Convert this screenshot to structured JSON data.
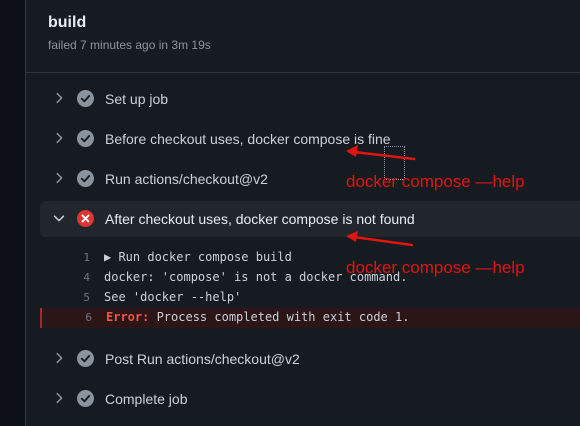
{
  "job": {
    "title": "build",
    "subtitle": "failed 7 minutes ago in 3m 19s"
  },
  "steps": [
    {
      "label": "Set up job",
      "status": "success"
    },
    {
      "label": "Before checkout uses, docker compose is fine",
      "status": "success"
    },
    {
      "label": "Run actions/checkout@v2",
      "status": "success"
    },
    {
      "label": "After checkout uses, docker compose is not found",
      "status": "failure"
    },
    {
      "label": "Post Run actions/checkout@v2",
      "status": "success"
    },
    {
      "label": "Complete job",
      "status": "success"
    }
  ],
  "log": [
    {
      "num": "1",
      "text": "▶ Run docker compose build"
    },
    {
      "num": "4",
      "text": "docker: 'compose' is not a docker command."
    },
    {
      "num": "5",
      "text": "See 'docker --help'"
    },
    {
      "num": "6",
      "keyword": "Error:",
      "text": " Process completed with exit code 1."
    }
  ],
  "annotations": [
    {
      "text": "docker compose —help",
      "color": "#e3130f"
    },
    {
      "text": "docker compose —help",
      "color": "#e3130f"
    }
  ],
  "colors": {
    "success": "#8b949e",
    "failure": "#da3633",
    "background": "#0d1117",
    "panel": "#161b22"
  }
}
